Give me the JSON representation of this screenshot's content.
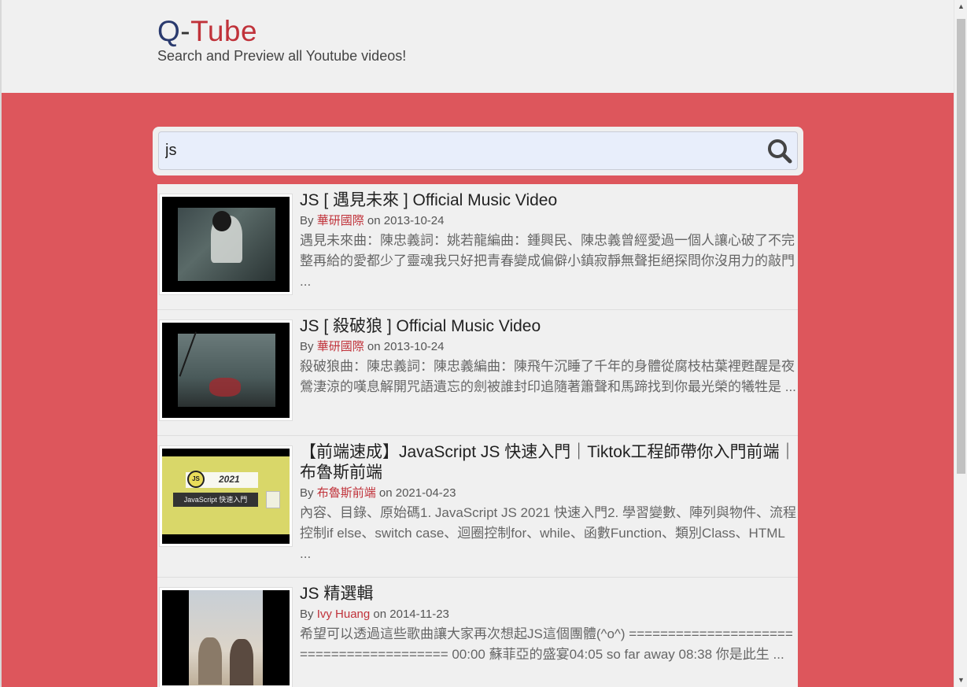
{
  "brand": {
    "q": "Q",
    "dash": "-",
    "tube": "Tube",
    "tagline": "Search and Preview all Youtube videos!"
  },
  "search": {
    "value": "js",
    "icon": "search-icon"
  },
  "colors": {
    "accent": "#dd565c",
    "brand_dark": "#2a3a6e",
    "brand_red": "#c0323a"
  },
  "results": [
    {
      "title": "JS [ 遇見未來 ] Official Music Video",
      "by": "By",
      "author": "華研國際",
      "on": "on",
      "date": "2013-10-24",
      "description": "遇見未來曲：陳忠義詞：姚若龍編曲：鍾興民、陳忠義曾經愛過一個人讓心破了不完整再給的愛都少了靈魂我只好把青春變成偏僻小鎮寂靜無聲拒絕探問你沒用力的敲門 ..."
    },
    {
      "title": "JS [ 殺破狼 ] Official Music Video",
      "by": "By",
      "author": "華研國際",
      "on": "on",
      "date": "2013-10-24",
      "description": "殺破狼曲：陳忠義詞：陳忠義編曲：陳飛午沉睡了千年的身體從腐枝枯葉裡甦醒是夜鶯淒涼的嘆息解開咒語遺忘的劍被誰封印追隨著簫聲和馬蹄找到你最光榮的犧牲是 ..."
    },
    {
      "title": "【前端速成】JavaScript JS 快速入門｜Tiktok工程師帶你入門前端｜布魯斯前端",
      "by": "By",
      "author": "布魯斯前端",
      "on": "on",
      "date": "2021-04-23",
      "description": "內容、目錄、原始碼1. JavaScript JS 2021 快速入門2. 學習變數、陣列與物件、流程控制if else、switch case、迴圈控制for、while、函數Function、類別Class、HTML ...",
      "thumb_badge": "JS",
      "thumb_year": "2021",
      "thumb_caption": "JavaScript 快速入門"
    },
    {
      "title": "JS 精選輯",
      "by": "By",
      "author": "Ivy Huang",
      "on": "on",
      "date": "2014-11-23",
      "description": "希望可以透過這些歌曲讓大家再次想起JS這個團體(^o^) ======================================== 00:00 蘇菲亞的盛宴04:05 so far away 08:38 你是此生 ..."
    }
  ]
}
